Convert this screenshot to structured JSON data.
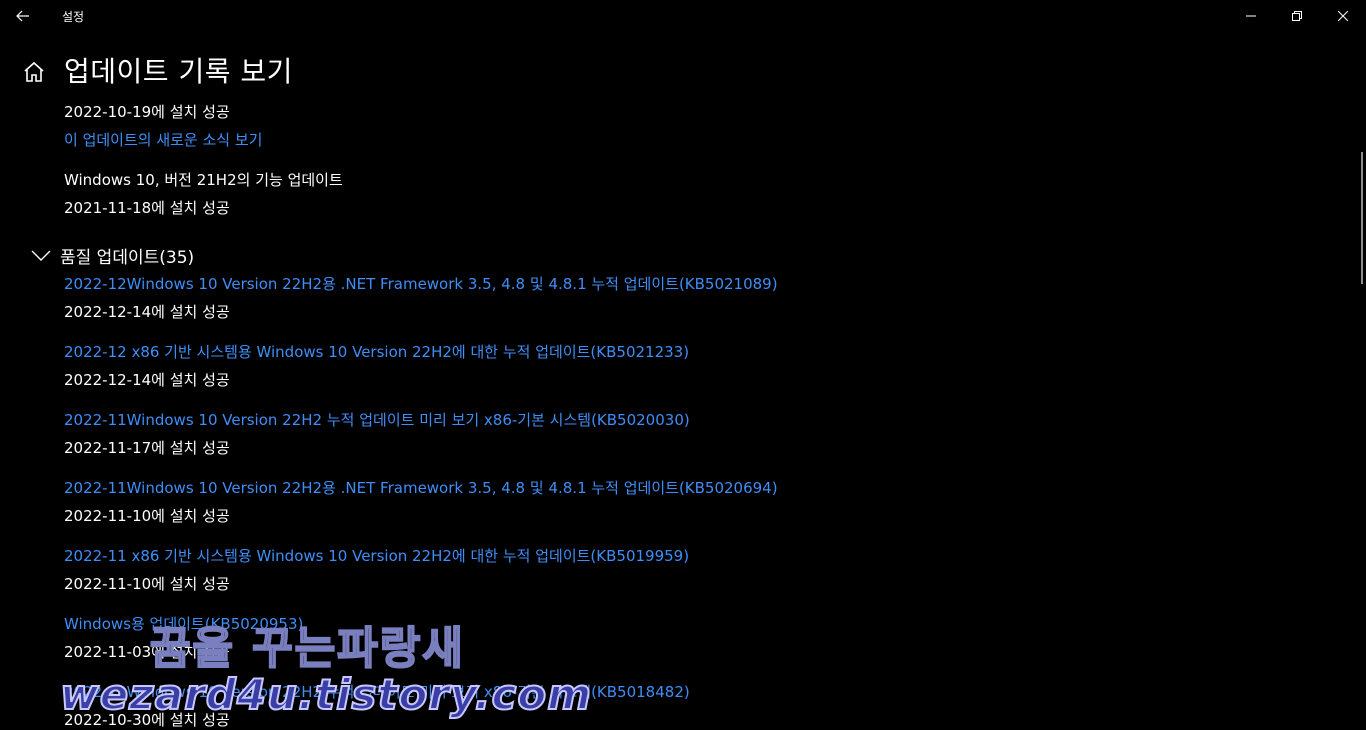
{
  "window": {
    "title": "설정"
  },
  "page": {
    "title": "업데이트 기록 보기"
  },
  "top_items": [
    {
      "status": "2022-10-19에 설치 성공",
      "link": "이 업데이트의 새로운 소식 보기"
    },
    {
      "name": "Windows 10, 버전 21H2의 기능 업데이트",
      "status": "2021-11-18에 설치 성공"
    }
  ],
  "quality_section": {
    "label": "품질 업데이트(35)",
    "items": [
      {
        "link": "2022-12Windows 10 Version 22H2용 .NET Framework 3.5, 4.8 및 4.8.1 누적 업데이트(KB5021089)",
        "status": "2022-12-14에 설치 성공"
      },
      {
        "link": "2022-12 x86 기반 시스템용 Windows 10 Version 22H2에 대한 누적 업데이트(KB5021233)",
        "status": "2022-12-14에 설치 성공"
      },
      {
        "link": "2022-11Windows 10 Version 22H2 누적 업데이트 미리 보기 x86-기본 시스템(KB5020030)",
        "status": "2022-11-17에 설치 성공"
      },
      {
        "link": "2022-11Windows 10 Version 22H2용 .NET Framework 3.5, 4.8 및 4.8.1 누적 업데이트(KB5020694)",
        "status": "2022-11-10에 설치 성공"
      },
      {
        "link": "2022-11 x86 기반 시스템용 Windows 10 Version 22H2에 대한 누적 업데이트(KB5019959)",
        "status": "2022-11-10에 설치 성공"
      },
      {
        "link": "Windows용 업데이트(KB5020953)",
        "status": "2022-11-03에 설치 성공"
      },
      {
        "link": "2022-10Windows 10 Version 22H2 누적 업데이트 미리 보기 x86-기본 시스템(KB5018482)",
        "status": "2022-10-30에 설치 성공"
      }
    ]
  },
  "watermark": {
    "line1": "꿈을 꾸는파랑새",
    "line2": "wezard4u.tistory.com"
  },
  "colors": {
    "background": "#000000",
    "link": "#3f8ef7",
    "text": "#ffffff"
  }
}
